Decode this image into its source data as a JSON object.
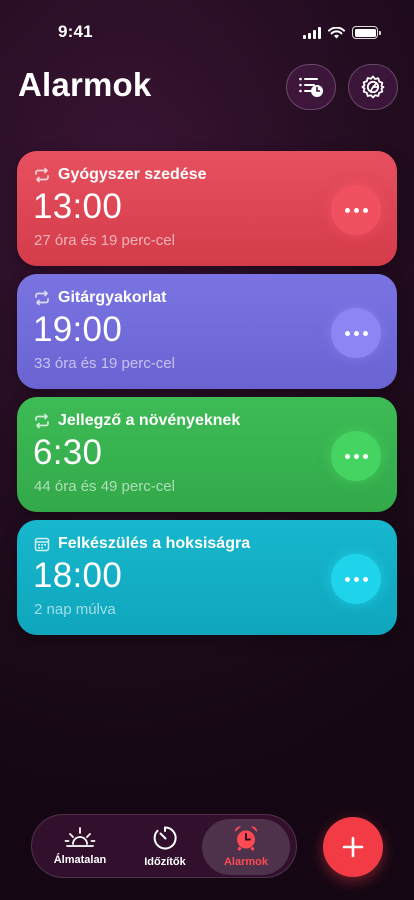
{
  "status_bar": {
    "time": "9:41"
  },
  "header": {
    "title": "Alarmok"
  },
  "alarms": [
    {
      "label": "Gyógyszer szedése",
      "time": "13:00",
      "subtitle": "27 óra és 19 perc-cel",
      "icon": "repeat-icon",
      "color": "#e04a58"
    },
    {
      "label": "Gitárgyakorlat",
      "time": "19:00",
      "subtitle": "33 óra és 19 perc-cel",
      "icon": "repeat-icon",
      "color": "#7069dc"
    },
    {
      "label": "Jellegző a növényeknek",
      "time": "6:30",
      "subtitle": "44 óra és 49 perc-cel",
      "icon": "repeat-icon",
      "color": "#37b24f"
    },
    {
      "label": "Felkészülés a hoksiságra",
      "time": "18:00",
      "subtitle": "2 nap múlva",
      "icon": "calendar-icon",
      "color": "#13afc6"
    }
  ],
  "tabs": [
    {
      "label": "Álmatalan",
      "icon": "sunrise-icon",
      "active": false
    },
    {
      "label": "Időzítők",
      "icon": "timer-icon",
      "active": false
    },
    {
      "label": "Alarmok",
      "icon": "alarm-clock-icon",
      "active": true
    }
  ],
  "colors": {
    "accent": "#f23b45",
    "background": "#250d22"
  }
}
